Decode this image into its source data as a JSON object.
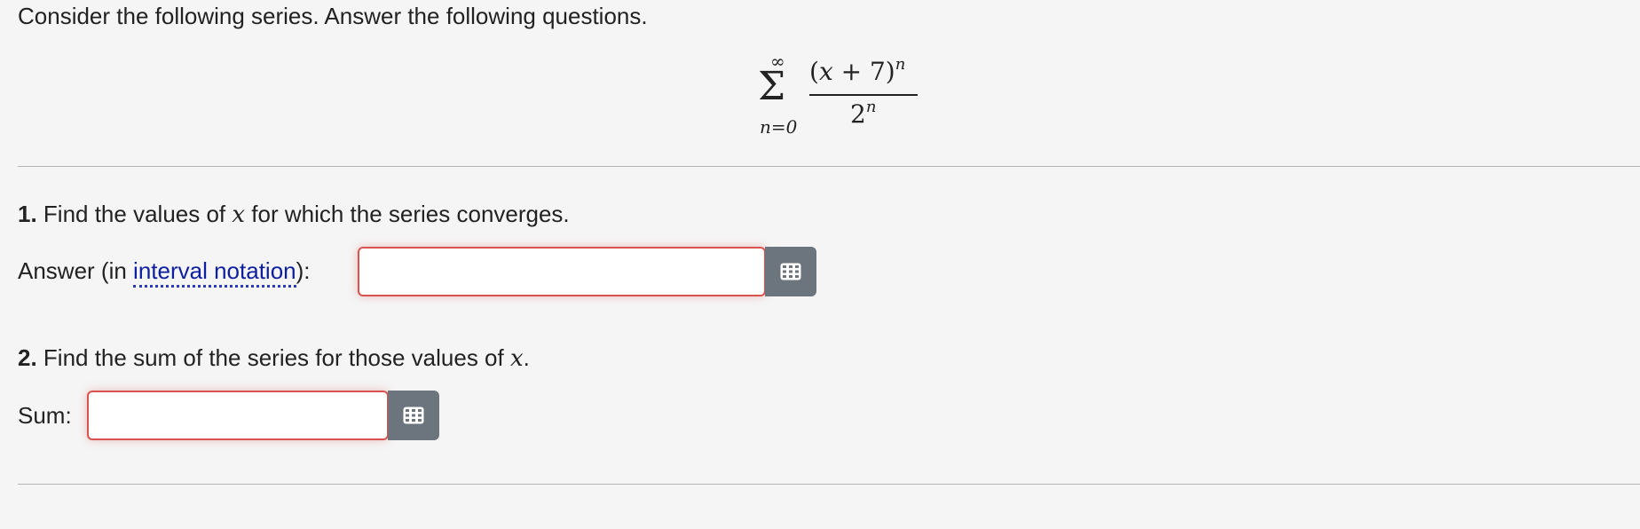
{
  "intro": "Consider the following series. Answer the following questions.",
  "series": {
    "upper": "∞",
    "lower": "n=0",
    "numerator_open": "(",
    "numerator_var": "x",
    "numerator_rest": " + 7)",
    "numerator_exp": "n",
    "denominator_base": "2",
    "denominator_exp": "n"
  },
  "q1": {
    "number": "1.",
    "text_before": " Find the values of ",
    "var": "x",
    "text_after": " for which the series converges.",
    "answer_prefix": "Answer (in ",
    "answer_link": "interval notation",
    "answer_suffix": "):",
    "value": ""
  },
  "q2": {
    "number": "2.",
    "text_before": " Find the sum of the series for those values of ",
    "var": "x",
    "text_after": ".",
    "label": "Sum:",
    "value": ""
  },
  "icons": {
    "keyboard": "keyboard-icon"
  },
  "colors": {
    "error_border": "#d9534f",
    "button_bg": "#6c757d",
    "link": "#0c1f9e"
  }
}
